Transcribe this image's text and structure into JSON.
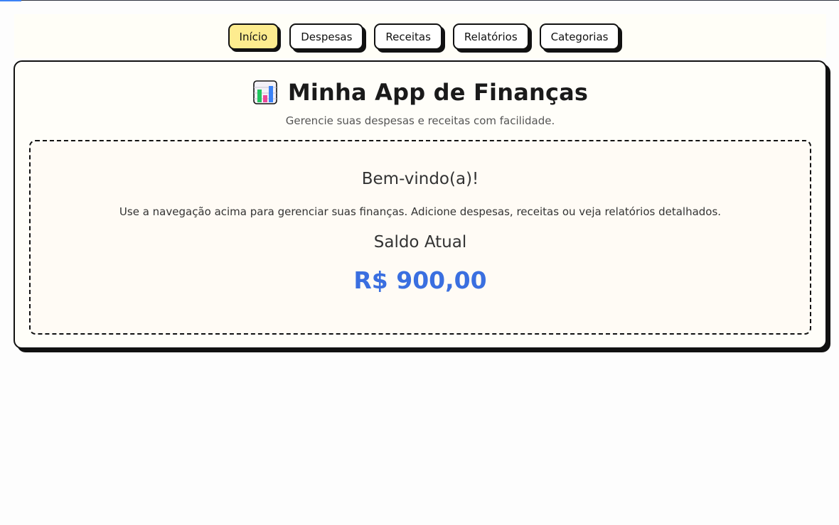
{
  "nav": {
    "items": [
      {
        "label": "Início",
        "active": true
      },
      {
        "label": "Despesas",
        "active": false
      },
      {
        "label": "Receitas",
        "active": false
      },
      {
        "label": "Relatórios",
        "active": false
      },
      {
        "label": "Categorias",
        "active": false
      }
    ]
  },
  "header": {
    "icon": "bar-chart-icon",
    "title": "Minha App de Finanças",
    "subtitle": "Gerencie suas despesas e receitas com facilidade."
  },
  "welcome": {
    "heading": "Bem-vindo(a)!",
    "description": "Use a navegação acima para gerenciar suas finanças. Adicione despesas, receitas ou veja relatórios detalhados.",
    "balance_label": "Saldo Atual",
    "balance_value": "R$ 900,00"
  },
  "colors": {
    "active_tab": "#fdec8f",
    "balance": "#3a6fe0",
    "border": "#111111"
  }
}
